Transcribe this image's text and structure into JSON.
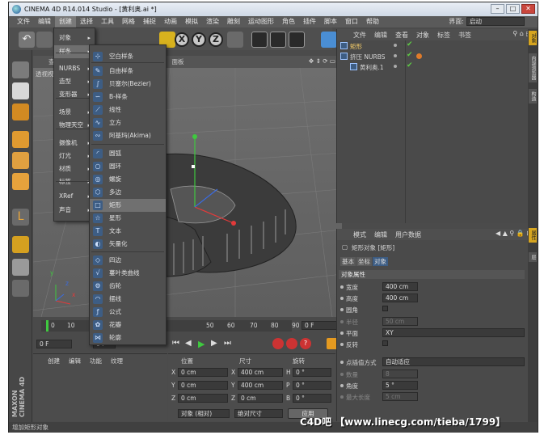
{
  "window": {
    "title": "CINEMA 4D R14.014 Studio - [黄利奥.ai *]",
    "layout_label": "界面:",
    "layout_value": "启动"
  },
  "menubar": {
    "items": [
      "文件",
      "编辑",
      "创建",
      "选择",
      "工具",
      "网格",
      "捕捉",
      "动画",
      "模拟",
      "渲染",
      "雕刻",
      "运动图形",
      "角色",
      "插件",
      "脚本",
      "窗口",
      "帮助"
    ],
    "active_index": 2
  },
  "create_menu": {
    "items": [
      "对象",
      "样条",
      "NURBS",
      "造型",
      "变形器",
      "场景",
      "物理天空",
      "摄像机",
      "灯光",
      "材质",
      "标签",
      "XRef",
      "声音"
    ],
    "highlight_index": 1
  },
  "spline_menu": {
    "items": [
      {
        "label": "空白样条",
        "icon": "empty-spline-icon",
        "glyph": "⊹"
      },
      {
        "label": "自由样条",
        "icon": "freehand-spline-icon",
        "glyph": "✎"
      },
      {
        "label": "贝塞尔(Bezier)",
        "icon": "bezier-icon",
        "glyph": "∫"
      },
      {
        "label": "B-样条",
        "icon": "b-spline-icon",
        "glyph": "∽"
      },
      {
        "label": "线性",
        "icon": "linear-icon",
        "glyph": "⟋"
      },
      {
        "label": "立方",
        "icon": "cubic-icon",
        "glyph": "∿"
      },
      {
        "label": "阿基玛(Akima)",
        "icon": "akima-icon",
        "glyph": "∾"
      },
      {
        "label": "圆弧",
        "icon": "arc-icon",
        "glyph": "◜"
      },
      {
        "label": "圆环",
        "icon": "circle-icon",
        "glyph": "○"
      },
      {
        "label": "螺旋",
        "icon": "helix-icon",
        "glyph": "◎"
      },
      {
        "label": "多边",
        "icon": "polygon-icon",
        "glyph": "⬡"
      },
      {
        "label": "矩形",
        "icon": "rectangle-icon",
        "glyph": "□"
      },
      {
        "label": "星形",
        "icon": "star-icon",
        "glyph": "☆"
      },
      {
        "label": "文本",
        "icon": "text-icon",
        "glyph": "T"
      },
      {
        "label": "矢量化",
        "icon": "vectorizer-icon",
        "glyph": "◐"
      },
      {
        "label": "四边",
        "icon": "four-side-icon",
        "glyph": "◇"
      },
      {
        "label": "蔓叶类曲线",
        "icon": "cissoid-icon",
        "glyph": "√"
      },
      {
        "label": "齿轮",
        "icon": "cogwheel-icon",
        "glyph": "⚙"
      },
      {
        "label": "摆线",
        "icon": "cycloid-icon",
        "glyph": "◠"
      },
      {
        "label": "公式",
        "icon": "formula-icon",
        "glyph": "ƒ"
      },
      {
        "label": "花瓣",
        "icon": "flower-icon",
        "glyph": "✿"
      },
      {
        "label": "轮廓",
        "icon": "profile-icon",
        "glyph": "⋈"
      }
    ],
    "highlight_index": 11
  },
  "viewport": {
    "menu_label": "查",
    "camera_label": "透视视",
    "panel_label": "面板",
    "axis_y": "y",
    "axis_x": "x",
    "axis_z": "z"
  },
  "toolbar": {
    "undo_label": "↶",
    "x_label": "X",
    "y_label": "Y",
    "z_label": "Z"
  },
  "timeline": {
    "ticks": [
      "0",
      "10",
      "50",
      "60",
      "70",
      "80",
      "90"
    ],
    "frame_start": "0",
    "frame_end": "0 F",
    "frame_left": "0 F",
    "frame_mid": "0 F",
    "frame_box": "0 F"
  },
  "material_panel": {
    "menu": [
      "创建",
      "编辑",
      "功能",
      "纹理"
    ]
  },
  "coord_panel": {
    "headers": [
      "位置",
      "尺寸",
      "旋转"
    ],
    "rows": [
      {
        "axis": "X",
        "pos": "0 cm",
        "size": "400 cm",
        "rot_label": "H",
        "rot": "0 °"
      },
      {
        "axis": "Y",
        "pos": "0 cm",
        "size": "400 cm",
        "rot_label": "P",
        "rot": "0 °"
      },
      {
        "axis": "Z",
        "pos": "0 cm",
        "size": "0 cm",
        "rot_label": "B",
        "rot": "0 °"
      }
    ],
    "mode_select": "对象 (相对)",
    "size_select": "绝对尺寸",
    "apply_label": "应用"
  },
  "object_manager": {
    "menu": [
      "文件",
      "编辑",
      "查看",
      "对象",
      "标签",
      "书签"
    ],
    "objects": [
      {
        "name": "矩形",
        "indent": 0,
        "selected": true
      },
      {
        "name": "挤压 NURBS",
        "indent": 0,
        "selected": false
      },
      {
        "name": "黄利奥.1",
        "indent": 1,
        "selected": false
      }
    ]
  },
  "attribute_manager": {
    "menu": [
      "模式",
      "编辑",
      "用户数据"
    ],
    "object_title": "矩形对象 [矩形]",
    "tabs": [
      "基本",
      "坐标",
      "对象"
    ],
    "active_tab": 2,
    "section_title": "对象属性",
    "props": [
      {
        "label": "宽度",
        "value": "400 cm",
        "type": "field",
        "enabled": true
      },
      {
        "label": "高度",
        "value": "400 cm",
        "type": "field",
        "enabled": true
      },
      {
        "label": "圆角",
        "value": "",
        "type": "check",
        "enabled": true
      },
      {
        "label": "半径",
        "value": "50 cm",
        "type": "field",
        "enabled": false
      },
      {
        "label": "平面",
        "value": "XY",
        "type": "select",
        "enabled": true
      },
      {
        "label": "反转",
        "value": "",
        "type": "check",
        "enabled": true
      },
      {
        "label": "点插值方式",
        "value": "自动适应",
        "type": "select",
        "enabled": true
      },
      {
        "label": "数量",
        "value": "8",
        "type": "field",
        "enabled": false
      },
      {
        "label": "角度",
        "value": "5 °",
        "type": "field",
        "enabled": true
      },
      {
        "label": "最大长度",
        "value": "5 cm",
        "type": "field",
        "enabled": false
      }
    ]
  },
  "right_tabs": [
    "对象",
    "内容浏览器",
    "构造",
    "属性",
    "层"
  ],
  "status": "增加矩形对象",
  "brand": "MAXON CINEMA 4D",
  "watermark": "C4D吧 【www.linecg.com/tieba/1799】",
  "colors": {
    "accent": "#d6a520",
    "selection": "#3d5d84",
    "check_green": "#5ecb45"
  }
}
